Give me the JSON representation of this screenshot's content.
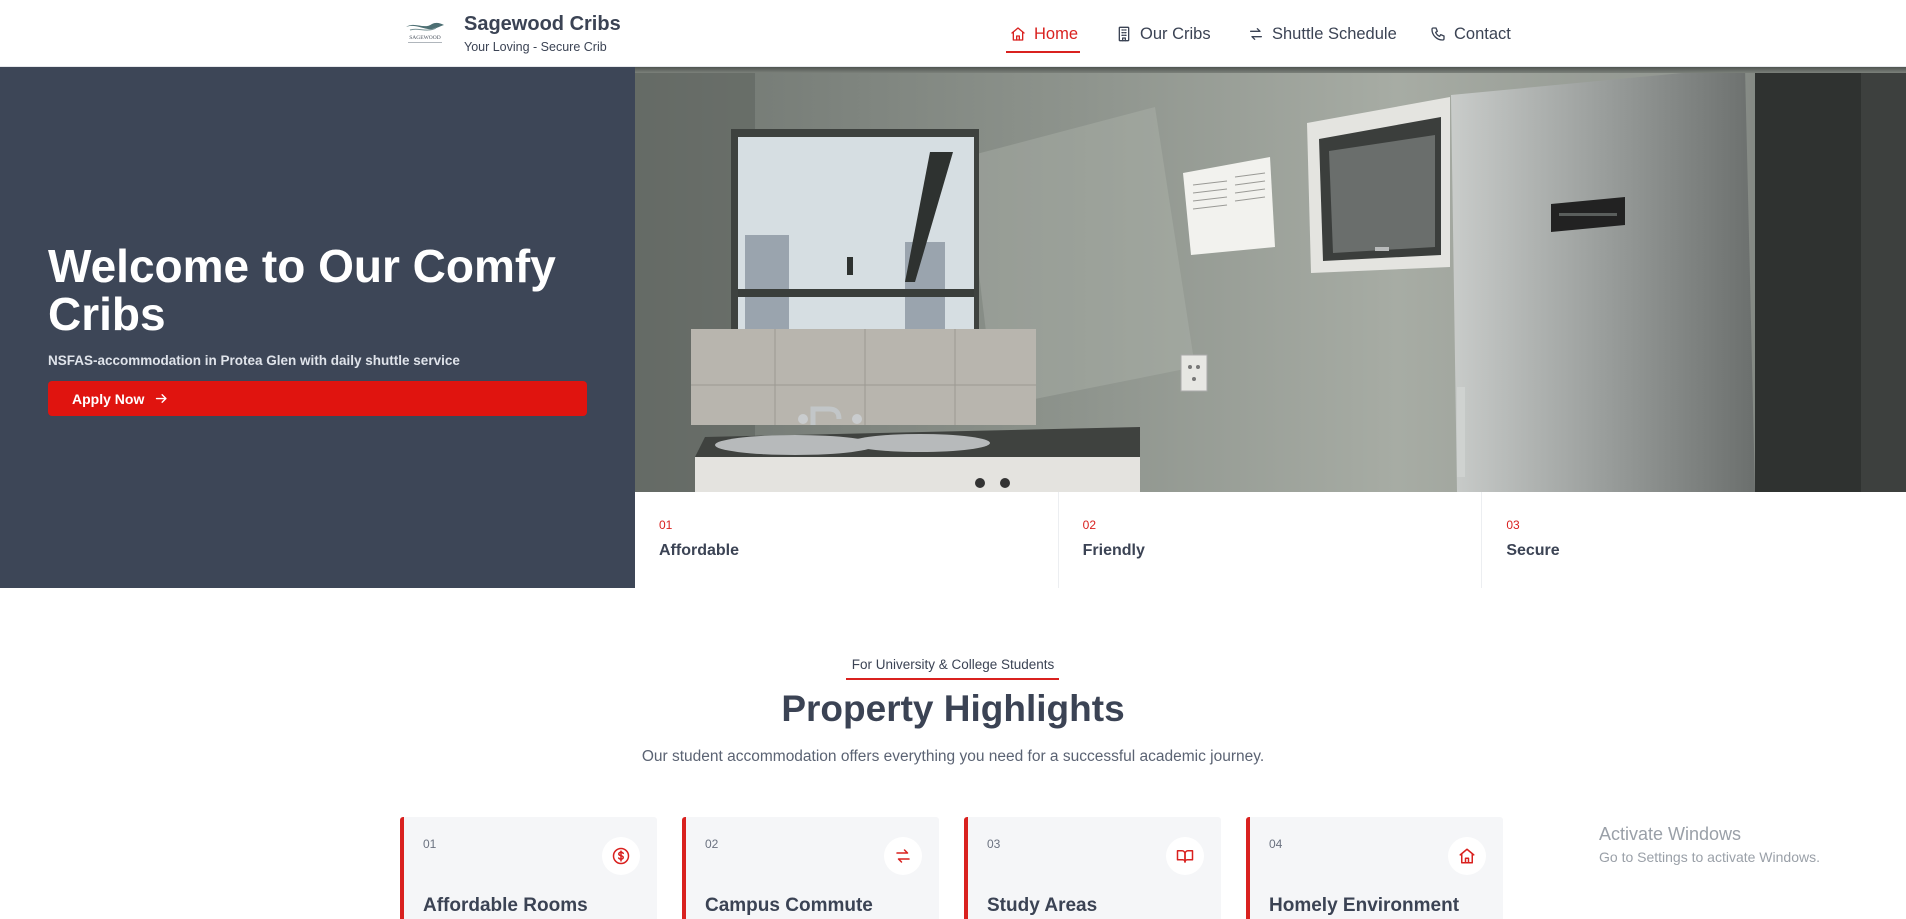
{
  "header": {
    "brand_title": "Sagewood Cribs",
    "brand_subtitle": "Your Loving - Secure Crib",
    "logo_text": "SAGEWOOD",
    "nav": [
      {
        "label": "Home",
        "icon": "home-icon",
        "active": true
      },
      {
        "label": "Our Cribs",
        "icon": "building-icon",
        "active": false
      },
      {
        "label": "Shuttle Schedule",
        "icon": "arrows-exchange-icon",
        "active": false
      },
      {
        "label": "Contact",
        "icon": "phone-icon",
        "active": false
      }
    ]
  },
  "hero": {
    "title": "Welcome to Our Comfy Cribs",
    "subtitle": "NSFAS-accommodation in Protea Glen with daily shuttle service",
    "cta_label": "Apply Now",
    "features": [
      {
        "number": "01",
        "label": "Affordable"
      },
      {
        "number": "02",
        "label": "Friendly"
      },
      {
        "number": "03",
        "label": "Secure"
      }
    ]
  },
  "highlights": {
    "eyebrow": "For University & College Students",
    "title": "Property Highlights",
    "subtitle": "Our student accommodation offers everything you need for a successful academic journey.",
    "cards": [
      {
        "number": "01",
        "title": "Affordable Rooms",
        "icon": "dollar-circle-icon"
      },
      {
        "number": "02",
        "title": "Campus Commute",
        "icon": "arrows-exchange-icon"
      },
      {
        "number": "03",
        "title": "Study Areas",
        "icon": "book-open-icon"
      },
      {
        "number": "04",
        "title": "Homely Environment",
        "icon": "home-icon"
      }
    ]
  },
  "watermark": {
    "line1": "Activate Windows",
    "line2": "Go to Settings to activate Windows."
  },
  "colors": {
    "accent": "#d9211f",
    "hero_panel": "#3d4657",
    "text": "#3b4354"
  }
}
